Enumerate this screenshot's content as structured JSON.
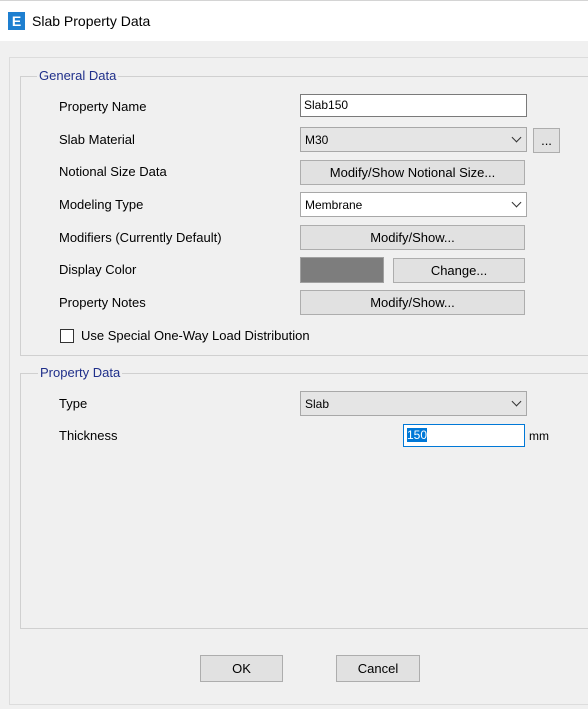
{
  "window": {
    "title": "Slab Property Data",
    "icon_letter": "E"
  },
  "general": {
    "group_title": "General Data",
    "property_name_label": "Property Name",
    "property_name_value": "Slab150",
    "slab_material_label": "Slab Material",
    "slab_material_value": "M30",
    "ellipsis_label": "...",
    "notional_label": "Notional Size Data",
    "notional_button": "Modify/Show Notional Size...",
    "modeling_type_label": "Modeling Type",
    "modeling_type_value": "Membrane",
    "modifiers_label": "Modifiers (Currently Default)",
    "modifiers_button": "Modify/Show...",
    "display_color_label": "Display Color",
    "display_color_value": "#7d7d7d",
    "change_button": "Change...",
    "notes_label": "Property Notes",
    "notes_button": "Modify/Show...",
    "one_way_checkbox_label": "Use Special One-Way Load Distribution",
    "one_way_checked": false
  },
  "property": {
    "group_title": "Property Data",
    "type_label": "Type",
    "type_value": "Slab",
    "thickness_label": "Thickness",
    "thickness_value": "150",
    "thickness_unit": "mm"
  },
  "footer": {
    "ok_label": "OK",
    "cancel_label": "Cancel"
  }
}
